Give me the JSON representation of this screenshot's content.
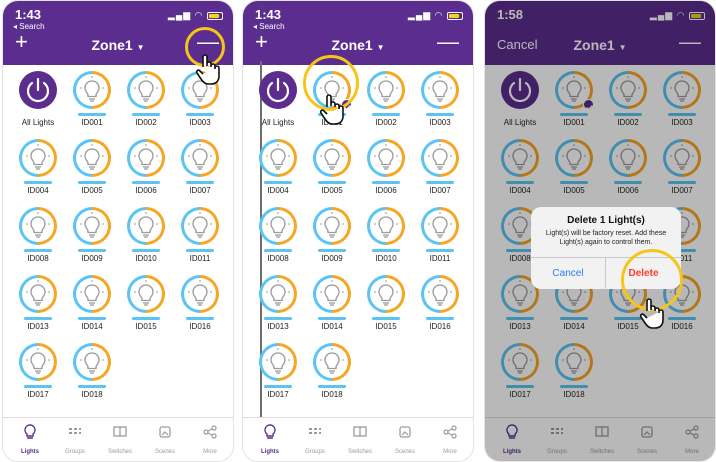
{
  "screens": [
    {
      "time": "1:43",
      "back": "◂ Search",
      "title": "Zone1",
      "left_action": "+",
      "right_action": "—"
    },
    {
      "time": "1:43",
      "back": "◂ Search",
      "title": "Zone1",
      "left_action": "+",
      "right_action": "—"
    },
    {
      "time": "1:58",
      "back": "",
      "title": "Zone1",
      "left_action": "Cancel",
      "right_action": "—"
    }
  ],
  "lights": [
    "All Lights",
    "ID001",
    "ID002",
    "ID003",
    "ID004",
    "ID005",
    "ID006",
    "ID007",
    "ID008",
    "ID009",
    "ID010",
    "ID011",
    "ID013",
    "ID014",
    "ID015",
    "ID016",
    "ID017",
    "ID018"
  ],
  "tabs": [
    "Lights",
    "Groups",
    "Switches",
    "Scenes",
    "More"
  ],
  "alert": {
    "title": "Delete 1 Light(s)",
    "message": "Light(s) will be factory reset. Add these Light(s) again to control them.",
    "cancel": "Cancel",
    "delete": "Delete"
  },
  "colors": {
    "brand": "#5b2d8e",
    "warm": "#f5a623",
    "cool": "#5bc4f1",
    "highlight": "#f5c518",
    "danger": "#ff3b30"
  },
  "icons": {
    "power": "power-icon",
    "bulb": "bulb-icon",
    "check": "check-icon",
    "pointer": "pointer-hand-icon"
  }
}
